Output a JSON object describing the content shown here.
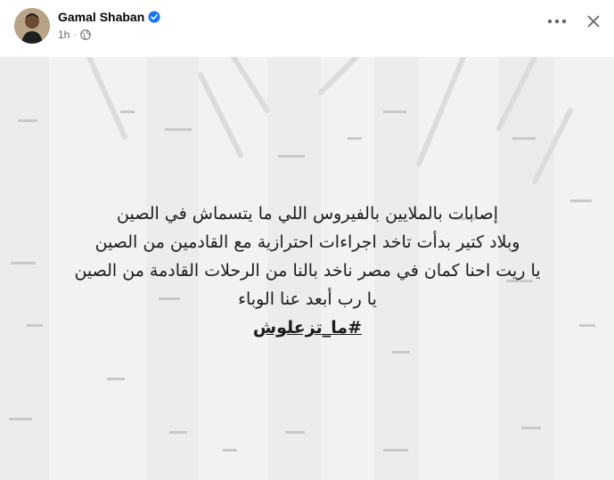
{
  "post": {
    "author": "Gamal Shaban",
    "time": "1h",
    "dot": "·",
    "verified": true,
    "privacy_icon": "globe-icon",
    "lines": [
      "إصابات بالملايين بالفيروس اللي ما يتسماش في الصين",
      "وبلاد كتير بدأت تاخد اجراءات احترازية مع القادمين من الصين",
      "يا ريت احنا كمان في مصر ناخد بالنا من الرحلات القادمة من الصين",
      "يا رب أبعد عنا الوباء"
    ],
    "hashtag": "#ما_تزعلوش"
  },
  "colors": {
    "verified_blue": "#1877f2",
    "text_secondary": "#65676b",
    "background_tile": "#f2f2f2"
  }
}
